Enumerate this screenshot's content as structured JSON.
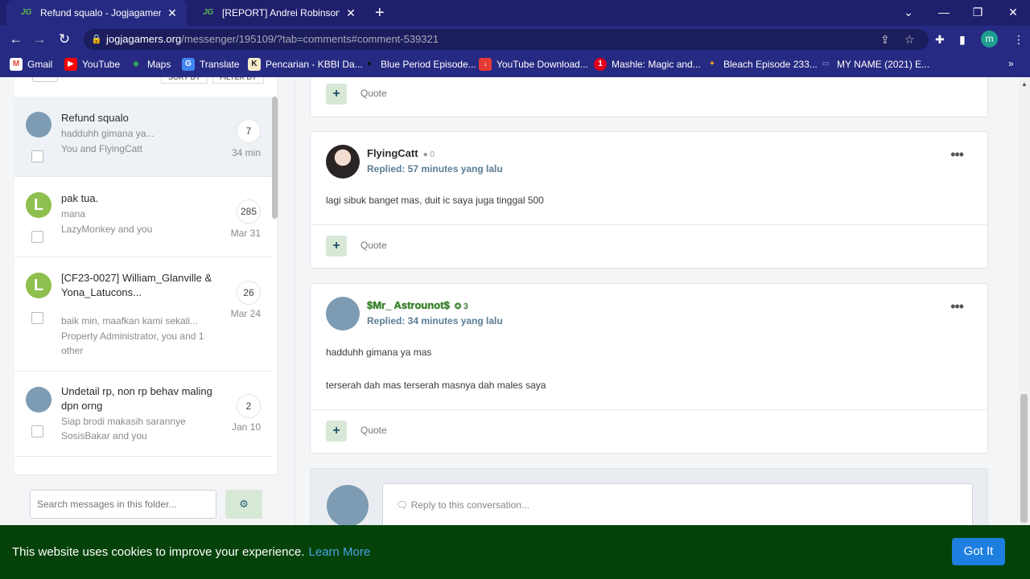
{
  "browser": {
    "tabs": [
      {
        "title": "Refund squalo - Jogjagamers Co",
        "favicon": "jg-logo-icon",
        "active": true
      },
      {
        "title": "[REPORT] Andrei Robinson - Pag",
        "favicon": "jg-logo-icon",
        "active": false
      }
    ],
    "favicon_text": "JG",
    "new_tab": "+",
    "address": {
      "host": "jogjagamers.org",
      "path": "/messenger/195109/?tab=comments#comment-539321"
    },
    "profile_initial": "m",
    "bookmarks": [
      {
        "label": "Gmail",
        "icon": "gmail-icon",
        "glyph": "M",
        "color": "#ea4335"
      },
      {
        "label": "YouTube",
        "icon": "youtube-icon",
        "glyph": "▶",
        "color": "#ff0000"
      },
      {
        "label": "Maps",
        "icon": "maps-icon",
        "glyph": "◆",
        "color": "#34a853"
      },
      {
        "label": "Translate",
        "icon": "translate-icon",
        "glyph": "G",
        "color": "#4285f4"
      },
      {
        "label": "Pencarian - KBBI Da...",
        "icon": "kbbi-icon",
        "glyph": "K",
        "color": "#f4e9c8"
      },
      {
        "label": "Blue Period Episode...",
        "icon": "blue-period-icon",
        "glyph": "●",
        "color": "#111111"
      },
      {
        "label": "YouTube Download...",
        "icon": "yt-download-icon",
        "glyph": "↓",
        "color": "#e53935"
      },
      {
        "label": "Mashle: Magic and...",
        "icon": "mashle-icon",
        "glyph": "1",
        "color": "#e0001b"
      },
      {
        "label": "Bleach Episode 233...",
        "icon": "bleach-icon",
        "glyph": "✦",
        "color": "#f0a030"
      },
      {
        "label": "MY NAME (2021) E...",
        "icon": "myname-icon",
        "glyph": "▭",
        "color": "#7b61ff"
      }
    ]
  },
  "left": {
    "sort_label": "SORT BY",
    "filter_label": "FILTER BY",
    "conversations": [
      {
        "title": "Refund squalo",
        "snippet": "hadduhh gimana ya...",
        "participants": "You and FlyingCatt",
        "count": "7",
        "date": "34 min",
        "avatar": "robot",
        "active": true
      },
      {
        "title": "pak tua.",
        "snippet": "mana",
        "participants": "LazyMonkey and you",
        "count": "285",
        "date": "Mar 31",
        "avatar": "L",
        "active": false
      },
      {
        "title": "[CF23-0027] William_Glanville & Yona_Latucons...",
        "snippet": "baik min, maafkan kami sekali...",
        "participants": "Property Administrator, you and 1 other",
        "count": "26",
        "date": "Mar 24",
        "avatar": "L",
        "active": false
      },
      {
        "title": "Undetail rp, non rp behav maling dpn orng",
        "snippet": "Siap brodi makasih sarannye",
        "participants": "SosisBakar and you",
        "count": "2",
        "date": "Jan 10",
        "avatar": "robot",
        "active": false
      }
    ],
    "search_placeholder": "Search messages in this folder...",
    "gear_icon": "⚙"
  },
  "messages": [
    {
      "user": "FlyingCatt",
      "points": "0",
      "replied": "Replied: 57 minutes yang lalu",
      "lines": [
        "lagi sibuk banget mas, duit ic saya juga tinggal 500"
      ],
      "avatar": "girl",
      "style": "plain"
    },
    {
      "user": "$Mr_ Astrounot$",
      "points": "3",
      "replied": "Replied: 34 minutes yang lalu",
      "lines": [
        "hadduhh gimana ya mas",
        "terserah dah mas terserah masnya dah males saya"
      ],
      "avatar": "robot",
      "style": "fancy"
    }
  ],
  "quote_label": "Quote",
  "plus_label": "+",
  "more_label": "•••",
  "reply_placeholder": "Reply to this conversation...",
  "cookie": {
    "text": "This website uses cookies to improve your experience.",
    "learn_more": "Learn More",
    "button": "Got It"
  },
  "colors": {
    "cookie_bg": "#044209",
    "accent": "#1e7fe0",
    "chrome": "#272a82"
  }
}
